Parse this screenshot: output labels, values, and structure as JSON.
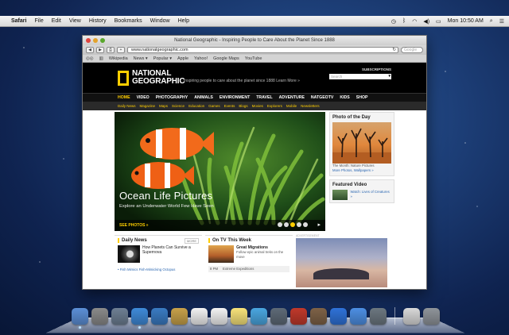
{
  "menubar": {
    "apple": "",
    "app": "Safari",
    "items": [
      "File",
      "Edit",
      "View",
      "History",
      "Bookmarks",
      "Window",
      "Help"
    ],
    "clock": "Mon 10:50 AM"
  },
  "browser": {
    "title": "National Geographic - Inspiring People to Care About the Planet Since 1888",
    "url": "www.nationalgeographic.com",
    "search_placeholder": "Google",
    "bookmarks": [
      "Wikipedia",
      "News ▾",
      "Popular ▾",
      "Apple",
      "Yahoo!",
      "Google Maps",
      "YouTube"
    ]
  },
  "ng": {
    "logo_line1": "NATIONAL",
    "logo_line2": "GEOGRAPHIC",
    "tagline": "Inspiring people to care about the planet since 1888  Learn More »",
    "subscribe": "SUBSCRIPTIONS",
    "search_placeholder": "Search",
    "nav": [
      "HOME",
      "VIDEO",
      "PHOTOGRAPHY",
      "ANIMALS",
      "ENVIRONMENT",
      "TRAVEL",
      "ADVENTURE",
      "NATGEOTV",
      "KIDS",
      "SHOP"
    ],
    "subnav": [
      "Daily News",
      "Magazine",
      "Maps",
      "Science",
      "Education",
      "Games",
      "Events",
      "Blogs",
      "Movies",
      "Explorers",
      "Mobile",
      "Newsletters"
    ],
    "hero": {
      "title": "Ocean Life Pictures",
      "subtitle": "Explore an Underwater World Few Have Seen",
      "cta": "SEE PHOTOS »"
    },
    "potd": {
      "heading": "Photo of the Day",
      "caption": "The Month: Nature Pictures",
      "link": "More Photos, Wallpapers »"
    },
    "featured_video": {
      "heading": "Featured Video",
      "caption": "Watch: Lives of Creatures »"
    },
    "daily_news": {
      "heading": "Daily News",
      "more": "MORE",
      "item_title": "How Planets Can Survive a Supernova",
      "item2": "• Fish Mimics Fish-Mimicking Octopus"
    },
    "on_tv": {
      "heading": "On TV This Week",
      "item_title": "Great Migrations",
      "item_text": "Follow epic animal treks on the move",
      "schedule_time": "8 PM",
      "schedule_show": "Extreme Expeditions"
    },
    "ad_label": "ADVERTISEMENT"
  },
  "dock": {
    "colors": [
      "#5c8fd6",
      "#8a8a8a",
      "#6e7f93",
      "#3f8ad8",
      "#3a7bc2",
      "#c7a14a",
      "#f2f2f2",
      "#f3f3f3",
      "#f7e27a",
      "#4aa6e0",
      "#5e6a77",
      "#c0392b",
      "#7e6247",
      "#2f72d8",
      "#4d8fe3",
      "#6c7780",
      "#d9d9d9",
      "#8f949a"
    ]
  }
}
